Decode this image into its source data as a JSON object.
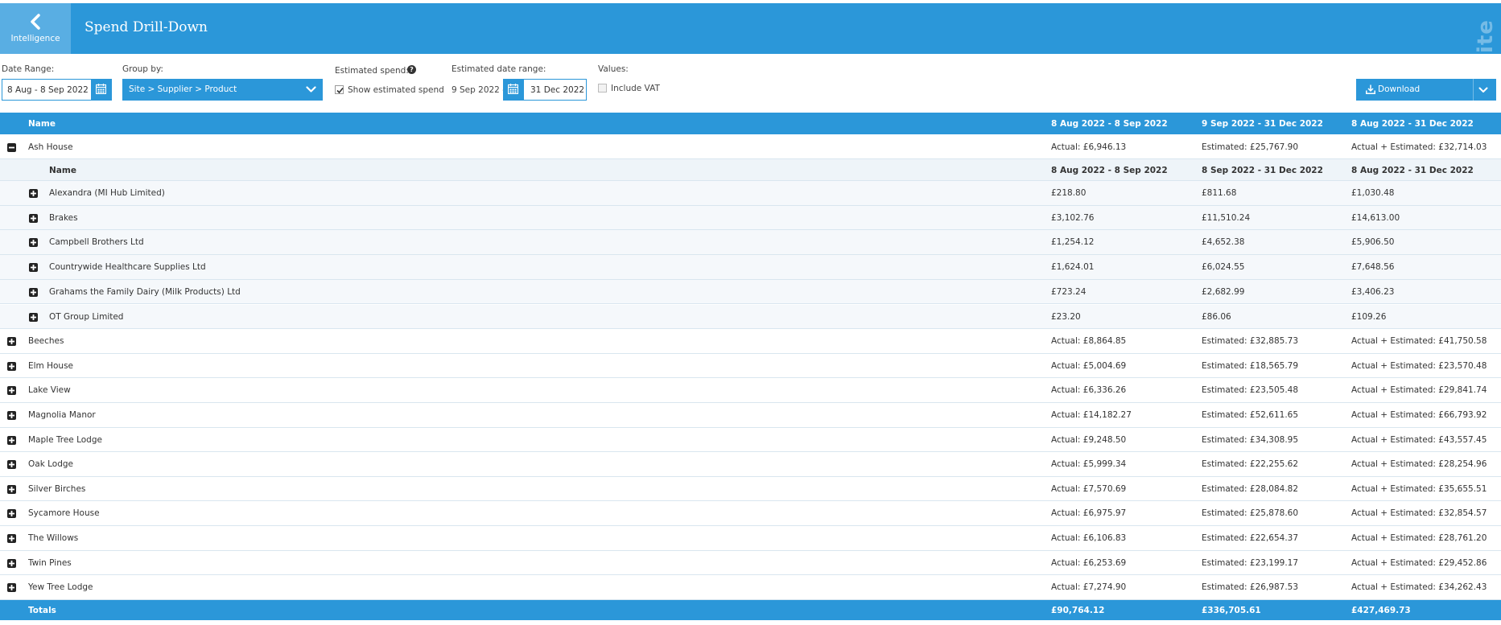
{
  "header": {
    "back_label": "Intelligence",
    "title": "Spend Drill-Down",
    "watermark": "Demo Site"
  },
  "filters": {
    "date_range_label": "Date Range:",
    "date_range_value": "8 Aug - 8 Sep 2022",
    "group_by_label": "Group by:",
    "group_by_value": "Site > Supplier > Product",
    "estimated_spend_label": "Estimated spend:",
    "show_estimated_label": "Show estimated spend",
    "show_estimated_checked": true,
    "estimated_date_range_label": "Estimated date range:",
    "estimated_from": "9 Sep 2022 -",
    "estimated_to": "31 Dec 2022",
    "values_label": "Values:",
    "include_vat_label": "Include VAT",
    "include_vat_checked": false,
    "download_label": "Download"
  },
  "table": {
    "header": {
      "name": "Name",
      "col1": "8 Aug 2022 - 8 Sep 2022",
      "col2": "9 Sep 2022 - 31 Dec 2022",
      "col3": "8 Aug 2022 - 31 Dec 2022"
    },
    "expanded_site": {
      "name": "Ash House",
      "col1": "Actual: £6,946.13",
      "col2": "Estimated: £25,767.90",
      "col3": "Actual + Estimated: £32,714.03"
    },
    "sub_header": {
      "name": "Name",
      "col1": "8 Aug 2022 - 8 Sep 2022",
      "col2": "8 Sep 2022 - 31 Dec 2022",
      "col3": "8 Aug 2022 - 31 Dec 2022"
    },
    "suppliers": [
      {
        "name": "Alexandra (MI Hub Limited)",
        "col1": "£218.80",
        "col2": "£811.68",
        "col3": "£1,030.48"
      },
      {
        "name": "Brakes",
        "col1": "£3,102.76",
        "col2": "£11,510.24",
        "col3": "£14,613.00"
      },
      {
        "name": "Campbell Brothers Ltd",
        "col1": "£1,254.12",
        "col2": "£4,652.38",
        "col3": "£5,906.50"
      },
      {
        "name": "Countrywide Healthcare Supplies Ltd",
        "col1": "£1,624.01",
        "col2": "£6,024.55",
        "col3": "£7,648.56"
      },
      {
        "name": "Grahams the Family Dairy (Milk Products) Ltd",
        "col1": "£723.24",
        "col2": "£2,682.99",
        "col3": "£3,406.23"
      },
      {
        "name": "OT Group Limited",
        "col1": "£23.20",
        "col2": "£86.06",
        "col3": "£109.26"
      }
    ],
    "sites": [
      {
        "name": "Beeches",
        "col1": "Actual: £8,864.85",
        "col2": "Estimated: £32,885.73",
        "col3": "Actual + Estimated: £41,750.58"
      },
      {
        "name": "Elm House",
        "col1": "Actual: £5,004.69",
        "col2": "Estimated: £18,565.79",
        "col3": "Actual + Estimated: £23,570.48"
      },
      {
        "name": "Lake View",
        "col1": "Actual: £6,336.26",
        "col2": "Estimated: £23,505.48",
        "col3": "Actual + Estimated: £29,841.74"
      },
      {
        "name": "Magnolia Manor",
        "col1": "Actual: £14,182.27",
        "col2": "Estimated: £52,611.65",
        "col3": "Actual + Estimated: £66,793.92"
      },
      {
        "name": "Maple Tree Lodge",
        "col1": "Actual: £9,248.50",
        "col2": "Estimated: £34,308.95",
        "col3": "Actual + Estimated: £43,557.45"
      },
      {
        "name": "Oak Lodge",
        "col1": "Actual: £5,999.34",
        "col2": "Estimated: £22,255.62",
        "col3": "Actual + Estimated: £28,254.96"
      },
      {
        "name": "Silver Birches",
        "col1": "Actual: £7,570.69",
        "col2": "Estimated: £28,084.82",
        "col3": "Actual + Estimated: £35,655.51"
      },
      {
        "name": "Sycamore House",
        "col1": "Actual: £6,975.97",
        "col2": "Estimated: £25,878.60",
        "col3": "Actual + Estimated: £32,854.57"
      },
      {
        "name": "The Willows",
        "col1": "Actual: £6,106.83",
        "col2": "Estimated: £22,654.37",
        "col3": "Actual + Estimated: £28,761.20"
      },
      {
        "name": "Twin Pines",
        "col1": "Actual: £6,253.69",
        "col2": "Estimated: £23,199.17",
        "col3": "Actual + Estimated: £29,452.86"
      },
      {
        "name": "Yew Tree Lodge",
        "col1": "Actual: £7,274.90",
        "col2": "Estimated: £26,987.53",
        "col3": "Actual + Estimated: £34,262.43"
      }
    ],
    "totals": {
      "name": "Totals",
      "col1": "£90,764.12",
      "col2": "£336,705.61",
      "col3": "£427,469.73"
    }
  },
  "colors": {
    "brand_blue": "#2b97d9",
    "back_button_blue": "#59aee3"
  },
  "icons": {
    "back": "chevron-left-icon",
    "calendar": "calendar-icon",
    "dropdown": "chevron-down-icon",
    "help": "question-circle-icon",
    "download": "download-icon",
    "expand": "plus-square-icon",
    "collapse": "minus-square-icon"
  }
}
